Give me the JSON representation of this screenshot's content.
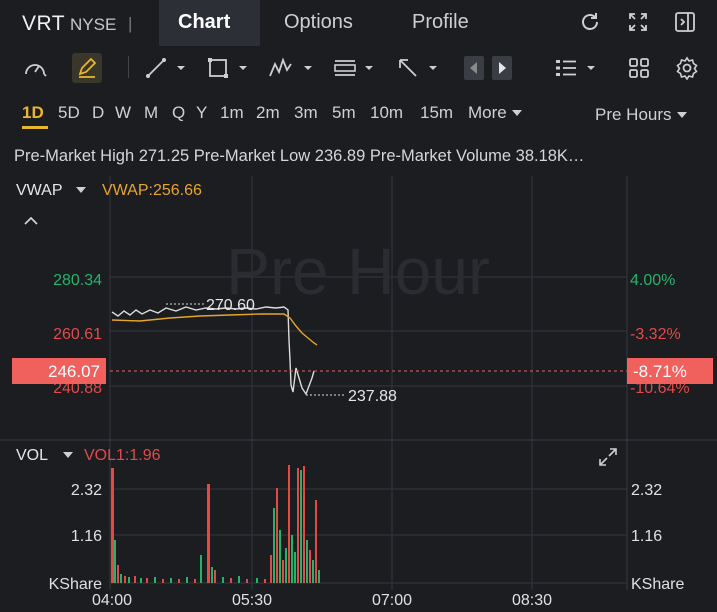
{
  "header": {
    "ticker": "VRT",
    "exchange": "NYSE",
    "separator": "|",
    "tabs": [
      {
        "label": "Chart",
        "active": true
      },
      {
        "label": "Options",
        "active": false
      },
      {
        "label": "Profile",
        "active": false
      }
    ]
  },
  "periods": {
    "items": [
      "1D",
      "5D",
      "D",
      "W",
      "M",
      "Q",
      "Y",
      "1m",
      "2m",
      "3m",
      "5m",
      "10m",
      "15m"
    ],
    "active": "1D",
    "more_label": "More",
    "session_label": "Pre Hours"
  },
  "info_line": "Pre-Market High 271.25 Pre-Market Low 236.89 Pre-Market Volume 38.18K…",
  "price_panel": {
    "indicator": "VWAP",
    "indicator_value": "VWAP:256.66",
    "watermark": "Pre Hour",
    "left_axis": [
      "280.34",
      "260.61",
      "240.88"
    ],
    "right_axis": [
      "4.00%",
      "-3.32%",
      "-10.64%"
    ],
    "current_price": "246.07",
    "current_pct": "-8.71%",
    "high_annotation": "270.60",
    "low_annotation": "237.88"
  },
  "volume_panel": {
    "indicator": "VOL",
    "indicator_value": "VOL1:1.96",
    "left_axis": [
      "2.32",
      "1.16",
      "KShare"
    ],
    "right_axis": [
      "2.32",
      "1.16",
      "KShare"
    ]
  },
  "x_axis": [
    "04:00",
    "05:30",
    "07:00",
    "08:30"
  ],
  "colors": {
    "up": "#25b36b",
    "down": "#e24a4a",
    "vwap": "#e8a52b",
    "accent": "#e9b62e",
    "price_tag": "#f0605d"
  },
  "chart_data": {
    "type": "line",
    "x": [
      "04:00",
      "05:30",
      "07:00",
      "08:30"
    ],
    "series": [
      {
        "name": "VWAP",
        "values": [
          266,
          267,
          268,
          268,
          258,
          256.66
        ]
      }
    ],
    "ylim": [
      240.88,
      280.34
    ]
  }
}
